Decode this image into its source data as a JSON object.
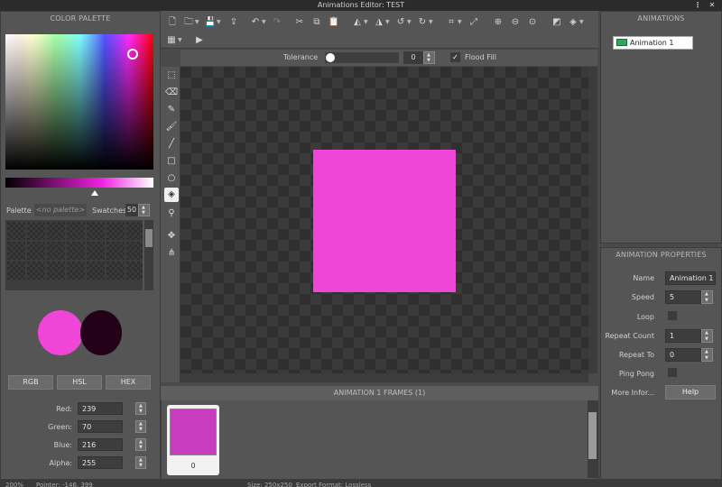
{
  "window": {
    "title": "Animations Editor: TEST",
    "menu_icon": "⋮",
    "close_icon": "✕"
  },
  "color_palette": {
    "header": "COLOR PALETTE",
    "palette_label": "Palette",
    "palette_value": "<no palette>",
    "swatches_label": "Swatches",
    "swatches_value": "50",
    "primary_color": "#ef46d8",
    "secondary_color": "#230118",
    "modes": [
      "RGB",
      "HSL",
      "HEX"
    ],
    "channels": [
      {
        "label": "Red:",
        "value": "239"
      },
      {
        "label": "Green:",
        "value": "70"
      },
      {
        "label": "Blue:",
        "value": "216"
      },
      {
        "label": "Alpha:",
        "value": "255"
      }
    ]
  },
  "toolbar": {
    "icons": [
      "new-file-icon",
      "open-folder-icon",
      "save-icon",
      "export-icon",
      "undo-icon",
      "redo-icon",
      "cut-icon",
      "copy-icon",
      "paste-icon",
      "flip-horizontal-icon",
      "flip-vertical-icon",
      "rotate-ccw-icon",
      "rotate-cw-icon",
      "crop-icon",
      "resize-icon",
      "zoom-in-icon",
      "zoom-out-icon",
      "zoom-reset-icon",
      "background-icon",
      "layers-icon",
      "grid-icon",
      "play-icon"
    ]
  },
  "tool_options": {
    "tolerance_label": "Tolerance",
    "tolerance_value": "0",
    "flood_fill_label": "Flood Fill",
    "flood_fill_checked": true
  },
  "tools": [
    "marquee-icon",
    "eraser-icon",
    "pencil-icon",
    "brush-icon",
    "line-icon",
    "rectangle-icon",
    "ellipse-icon",
    "fill-bucket-icon",
    "eyedropper-icon",
    "move-anchor-icon",
    "bone-icon"
  ],
  "canvas": {
    "sprite_color": "#ef46d8"
  },
  "frames": {
    "header": "ANIMATION 1 FRAMES (1)",
    "items": [
      {
        "number": "0",
        "color": "#c83cc0"
      }
    ]
  },
  "animations": {
    "header": "ANIMATIONS",
    "items": [
      {
        "name": "Animation 1"
      }
    ]
  },
  "properties": {
    "header": "ANIMATION PROPERTIES",
    "name_label": "Name",
    "name_value": "Animation 1",
    "speed_label": "Speed",
    "speed_value": "5",
    "loop_label": "Loop",
    "repeat_count_label": "Repeat Count",
    "repeat_count_value": "1",
    "repeat_to_label": "Repeat To",
    "repeat_to_value": "0",
    "ping_pong_label": "Ping Pong",
    "more_info_label": "More Infor...",
    "help_label": "Help"
  },
  "status": {
    "zoom": "200%",
    "pointer": "Pointer: -146, 399",
    "size": "Size: 250x250",
    "export": "Export Format: Lossless"
  }
}
